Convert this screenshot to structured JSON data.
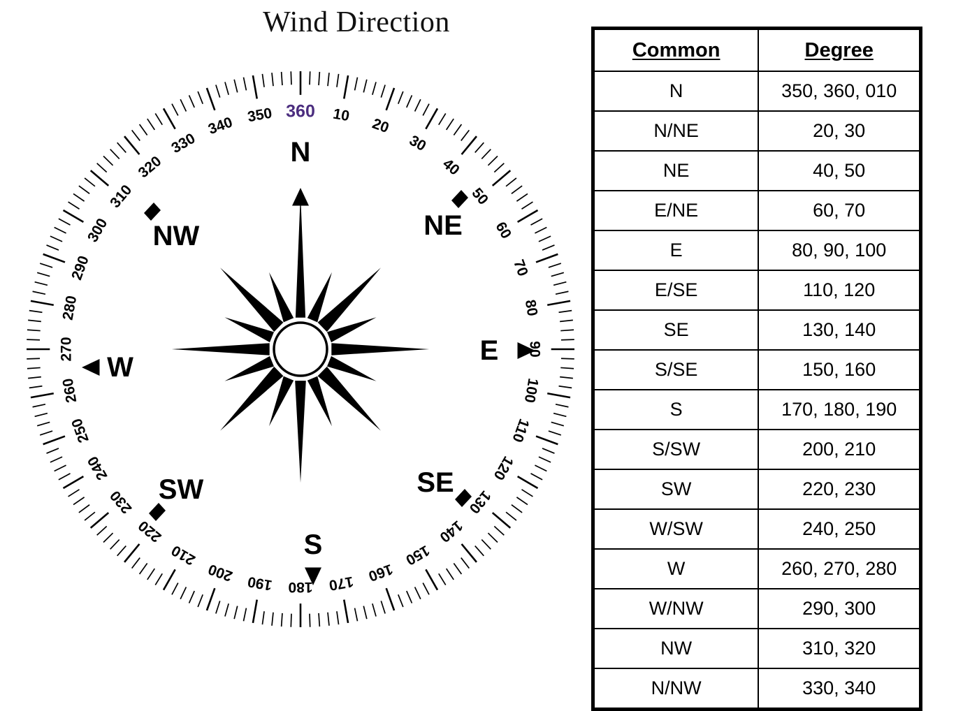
{
  "title": "Wind Direction",
  "colors": {
    "ink": "#000000",
    "north_label_360": "#4b2d7f",
    "background": "#ffffff"
  },
  "compass": {
    "cardinals": [
      {
        "label": "N",
        "marker": "triangle-up",
        "bearing": 0
      },
      {
        "label": "NE",
        "marker": "diamond",
        "bearing": 45
      },
      {
        "label": "E",
        "marker": "triangle-right",
        "bearing": 90
      },
      {
        "label": "SE",
        "marker": "diamond",
        "bearing": 135
      },
      {
        "label": "S",
        "marker": "triangle-down",
        "bearing": 180
      },
      {
        "label": "SW",
        "marker": "diamond",
        "bearing": 225
      },
      {
        "label": "W",
        "marker": "triangle-left",
        "bearing": 270
      },
      {
        "label": "NW",
        "marker": "diamond",
        "bearing": 315
      }
    ],
    "degree_labels": [
      "360",
      "10",
      "20",
      "30",
      "40",
      "50",
      "60",
      "70",
      "80",
      "90",
      "100",
      "110",
      "120",
      "130",
      "140",
      "150",
      "160",
      "170",
      "180",
      "190",
      "200",
      "210",
      "220",
      "230",
      "240",
      "250",
      "260",
      "270",
      "280",
      "290",
      "300",
      "310",
      "320",
      "330",
      "340",
      "350"
    ],
    "north_label": "360",
    "minor_tick_interval_deg": 2,
    "major_tick_interval_deg": 10,
    "rose_points": 16,
    "rose_hub": "white-circle"
  },
  "table": {
    "headers": [
      "Common",
      "Degree"
    ],
    "rows": [
      {
        "common": "N",
        "degree": "350, 360, 010"
      },
      {
        "common": "N/NE",
        "degree": "20, 30"
      },
      {
        "common": "NE",
        "degree": "40, 50"
      },
      {
        "common": "E/NE",
        "degree": "60, 70"
      },
      {
        "common": "E",
        "degree": "80, 90, 100"
      },
      {
        "common": "E/SE",
        "degree": "110, 120"
      },
      {
        "common": "SE",
        "degree": "130, 140"
      },
      {
        "common": "S/SE",
        "degree": "150, 160"
      },
      {
        "common": "S",
        "degree": "170, 180, 190"
      },
      {
        "common": "S/SW",
        "degree": "200, 210"
      },
      {
        "common": "SW",
        "degree": "220, 230"
      },
      {
        "common": "W/SW",
        "degree": "240, 250"
      },
      {
        "common": "W",
        "degree": "260, 270, 280"
      },
      {
        "common": "W/NW",
        "degree": "290, 300"
      },
      {
        "common": "NW",
        "degree": "310, 320"
      },
      {
        "common": "N/NW",
        "degree": "330, 340"
      }
    ]
  }
}
